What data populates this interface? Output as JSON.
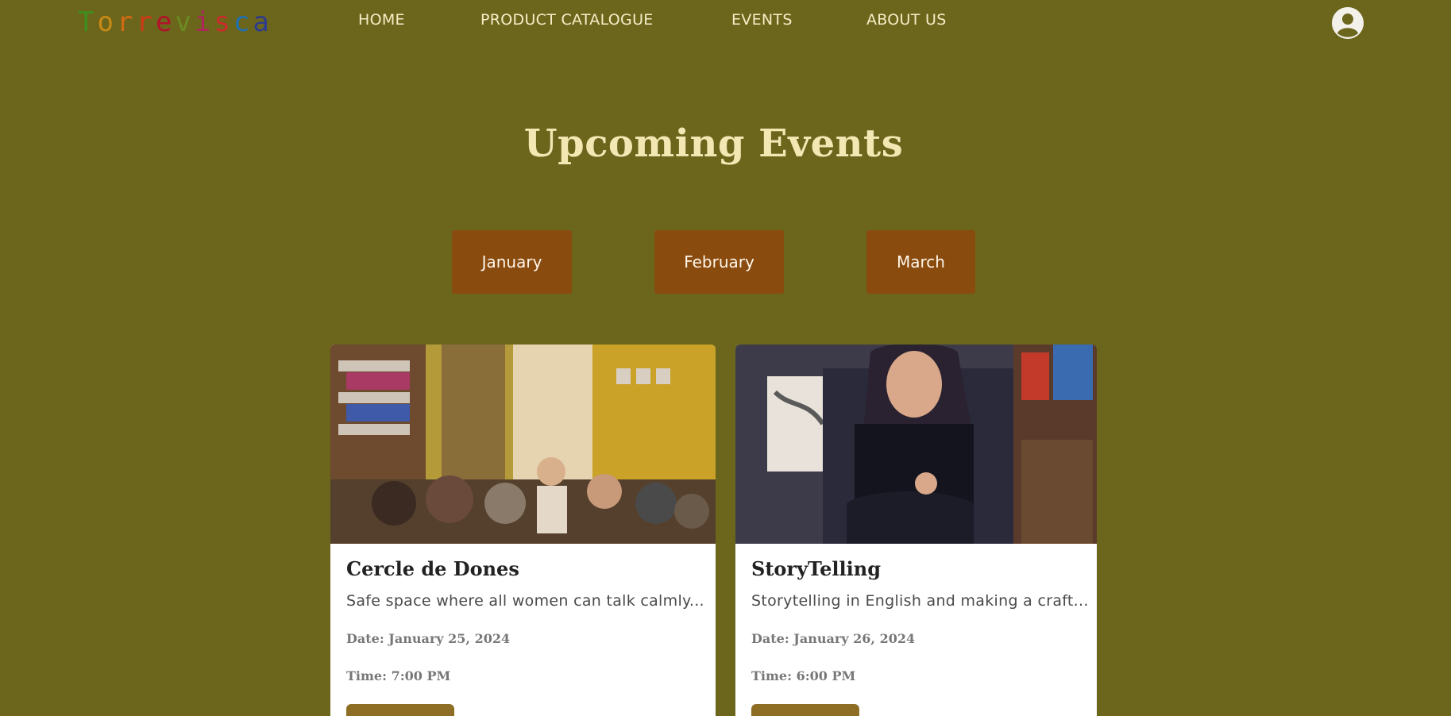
{
  "header": {
    "logo_text": "Torrevisca",
    "logo_letter_colors": [
      "#3d8f1e",
      "#c98a14",
      "#d06a12",
      "#cf3a16",
      "#b3122a",
      "#6c8a22",
      "#b0245c",
      "#cc2a2a",
      "#1f6fb0",
      "#2e3c8f"
    ],
    "nav": [
      "HOME",
      "PRODUCT CATALOGUE",
      "EVENTS",
      "ABOUT US"
    ],
    "avatar_icon": "user-circle-icon"
  },
  "page_title": "Upcoming Events",
  "months": [
    "January",
    "February",
    "March"
  ],
  "events": [
    {
      "title": "Cercle de Dones",
      "description": "Safe space where all women can talk calmly...",
      "date": "Date: January 25, 2024",
      "time": "Time: 7:00 PM",
      "image_icon": "group-photo-icon"
    },
    {
      "title": "StoryTelling",
      "description": "Storytelling in English and making a craft...",
      "date": "Date: January 26, 2024",
      "time": "Time: 6:00 PM",
      "image_icon": "storyteller-photo-icon"
    }
  ],
  "colors": {
    "background": "#6c661d",
    "month_button": "#8a4b0f",
    "title": "#f3e7b3",
    "card_button": "#8e6d25"
  }
}
